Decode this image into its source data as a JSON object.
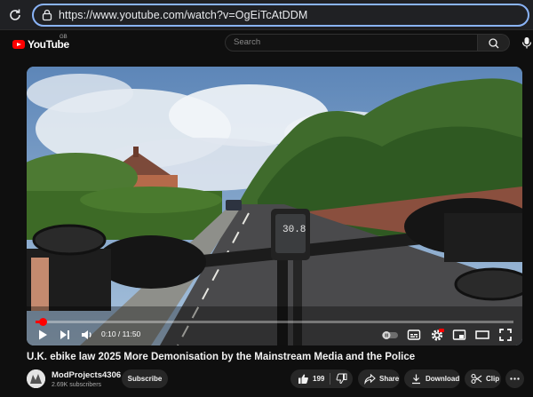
{
  "browser": {
    "url": "https://www.youtube.com/watch?v=OgEiTcAtDDM"
  },
  "header": {
    "logo_text": "YouTube",
    "region": "GB",
    "search_placeholder": "Search"
  },
  "player": {
    "current_time": "0:10",
    "duration": "11:50",
    "time_display": "0:10 / 11:50",
    "progress_fraction": 0.014,
    "speedometer_reading": "30.8",
    "autoplay": "off",
    "hd_badge": "HD"
  },
  "video": {
    "title": "U.K. ebike law 2025 More Demonisation by the Mainstream Media and the Police"
  },
  "channel": {
    "name": "ModProjects4306",
    "subscribers": "2.69K subscribers",
    "subscribe_label": "Subscribe"
  },
  "actions": {
    "likes": "199",
    "share_label": "Share",
    "download_label": "Download",
    "clip_label": "Clip"
  },
  "colors": {
    "accent": "#ff0000",
    "focus_ring": "#8ab4f8",
    "background": "#0f0f0f",
    "pill": "#272727"
  },
  "icons": [
    "reload-icon",
    "lock-icon",
    "youtube-logo",
    "search-icon",
    "mic-icon",
    "play-icon",
    "next-icon",
    "volume-icon",
    "autoplay-toggle",
    "subtitles-icon",
    "settings-icon",
    "miniplayer-icon",
    "theater-icon",
    "fullscreen-icon",
    "like-icon",
    "dislike-icon",
    "share-icon",
    "download-icon",
    "clip-icon",
    "more-icon"
  ]
}
